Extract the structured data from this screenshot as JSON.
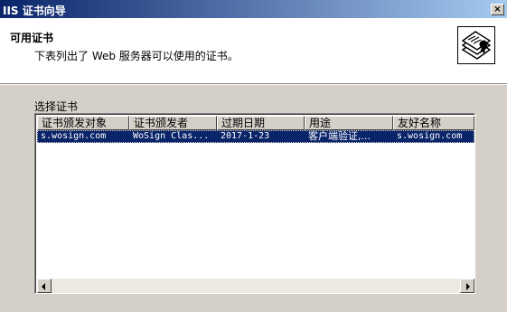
{
  "window": {
    "title": "IIS 证书向导",
    "close_label": "×"
  },
  "header": {
    "title": "可用证书",
    "subtitle": "下表列出了 Web 服务器可以使用的证书。",
    "icon": "certificate-wizard-icon"
  },
  "list": {
    "label": "选择证书",
    "columns": [
      "证书颁发对象",
      "证书颁发者",
      "过期日期",
      "用途",
      "友好名称"
    ],
    "rows": [
      {
        "issued_to": "s.wosign.com",
        "issuer": "WoSign Clas...",
        "expires": "2017-1-23",
        "purpose": "客户端验证,...",
        "friendly_name": "s.wosign.com"
      }
    ]
  },
  "colors": {
    "selection": "#0a246a",
    "titlebar": "#0a246a",
    "face": "#d4d0c8"
  }
}
